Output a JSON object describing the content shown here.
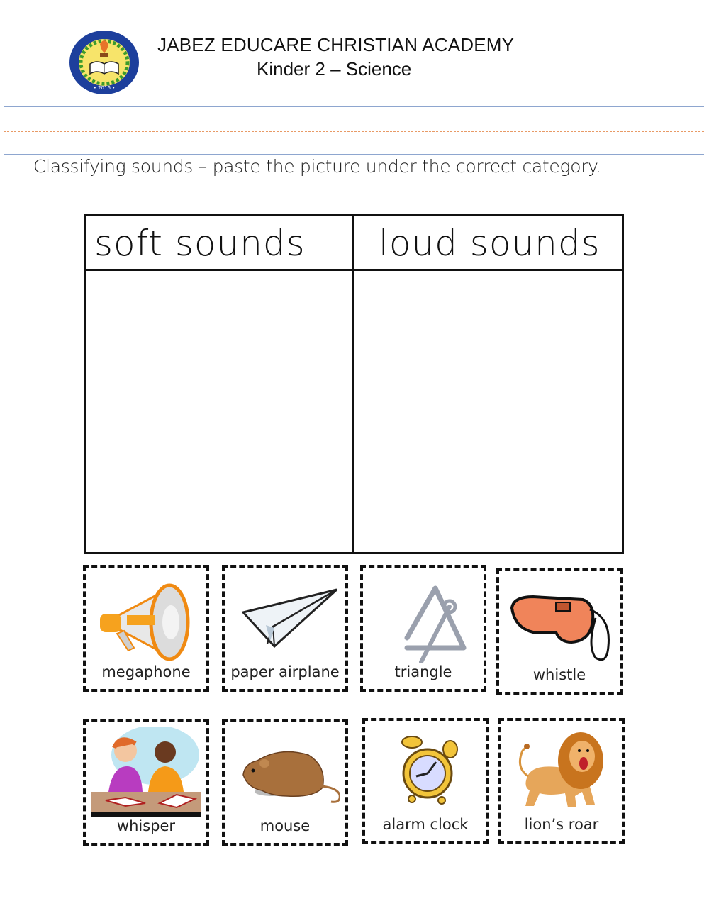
{
  "header": {
    "school_name": "JABEZ EDUCARE CHRISTIAN ACADEMY",
    "subject": "Kinder 2  – Science",
    "logo": {
      "icon": "school-seal-icon",
      "ring_text": "JABEZ EDUCARE CHRISTIAN ACADEMY",
      "year": "• 2016 •"
    }
  },
  "instruction": "Classifying sounds – paste the picture under the correct category.",
  "table": {
    "columns": [
      {
        "label": "soft sounds",
        "contents": []
      },
      {
        "label": "loud sounds",
        "contents": []
      }
    ]
  },
  "cards": [
    {
      "label": "megaphone",
      "icon": "megaphone-icon"
    },
    {
      "label": "paper airplane",
      "icon": "paper-airplane-icon"
    },
    {
      "label": "triangle",
      "icon": "triangle-instrument-icon"
    },
    {
      "label": "whistle",
      "icon": "whistle-icon"
    },
    {
      "label": "whisper",
      "icon": "whispering-children-icon"
    },
    {
      "label": "mouse",
      "icon": "mouse-icon"
    },
    {
      "label": "alarm clock",
      "icon": "alarm-clock-icon"
    },
    {
      "label": "lion’s roar",
      "icon": "lion-icon"
    }
  ],
  "colors": {
    "rule_blue": "#8ea6cf",
    "rule_orange": "#e89a66",
    "seal_blue": "#1d3f9c",
    "megaphone_orange": "#f08a12",
    "whistle_orange": "#f0845a",
    "lion_tan": "#d9953e"
  }
}
